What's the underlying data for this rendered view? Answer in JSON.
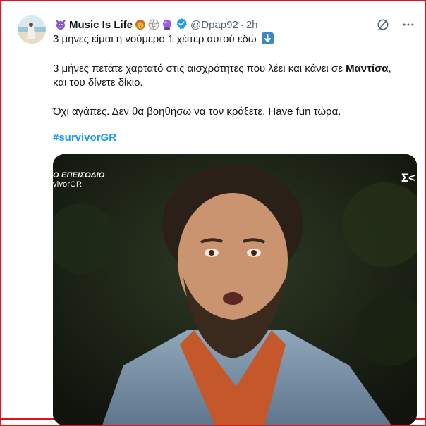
{
  "tweet": {
    "display_name": "Music Is Life",
    "handle": "@Dpap92",
    "separator": "·",
    "time": "2h",
    "emojis": [
      "devil-face",
      "lion-face",
      "volleyball",
      "crystal-ball"
    ],
    "line1": "3 μηνες είμαι η νούμερο 1 χέιτερ αυτού εδώ",
    "line2_pre": "3 μήνες πετάτε χαρτατό στις αισχρότητες που λέει και κάνει σε ",
    "line2_bold": "Μαντίσα",
    "line2_post": ",",
    "line3": "και του δίνετε δίκιο.",
    "line4": "Όχι αγάπες. Δεν θα βοηθήσω να τον κράξετε. Have fun τώρα.",
    "hashtag": "#survivorGR"
  },
  "media": {
    "overlay_title": "Ο ΕΠΕΙΣΟΔΙΟ",
    "overlay_tag": "vivorGR",
    "overlay_logo": "Σ<"
  },
  "colors": {
    "frame": "#e0141e",
    "link": "#1d9bf0",
    "verified": "#1d9bf0",
    "muted": "#536471"
  }
}
